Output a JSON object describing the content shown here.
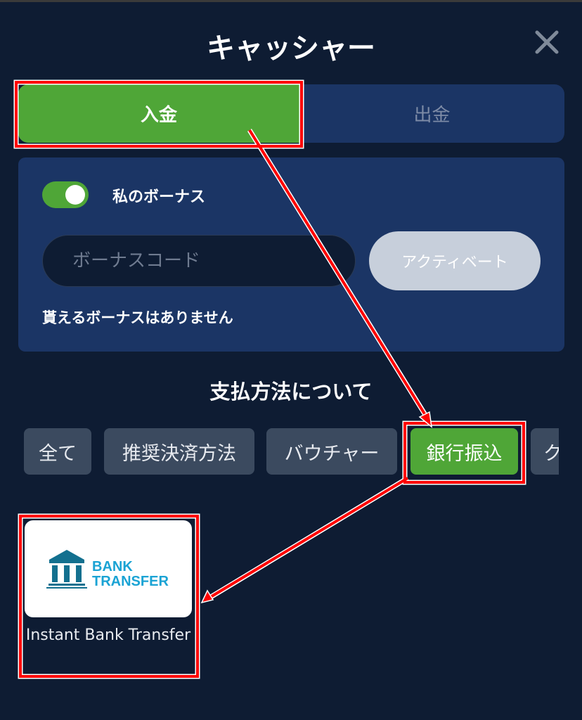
{
  "header": {
    "title": "キャッシャー",
    "close_icon": "close-icon"
  },
  "tabs": [
    {
      "label": "入金",
      "active": true
    },
    {
      "label": "出金",
      "active": false
    }
  ],
  "bonus": {
    "toggle_on": true,
    "label": "私のボーナス",
    "code_placeholder": "ボーナスコード",
    "code_value": "",
    "activate_label": "アクティベート",
    "status": "貰えるボーナスはありません"
  },
  "payment": {
    "section_title": "支払方法について",
    "categories": [
      "全て",
      "推奨決済方法",
      "バウチャー",
      "銀行振込",
      "ク"
    ],
    "selected_category": "銀行振込",
    "methods": [
      {
        "name": "Instant Bank Transfer",
        "logo_text": "BANK TRANSFER",
        "logo_icon": "bank-building-icon"
      }
    ]
  },
  "colors": {
    "background": "#0e1c33",
    "panel": "#1b3565",
    "accent_green": "#4fa637",
    "chip": "#3b4a5f",
    "annotation": "#ff0000"
  }
}
